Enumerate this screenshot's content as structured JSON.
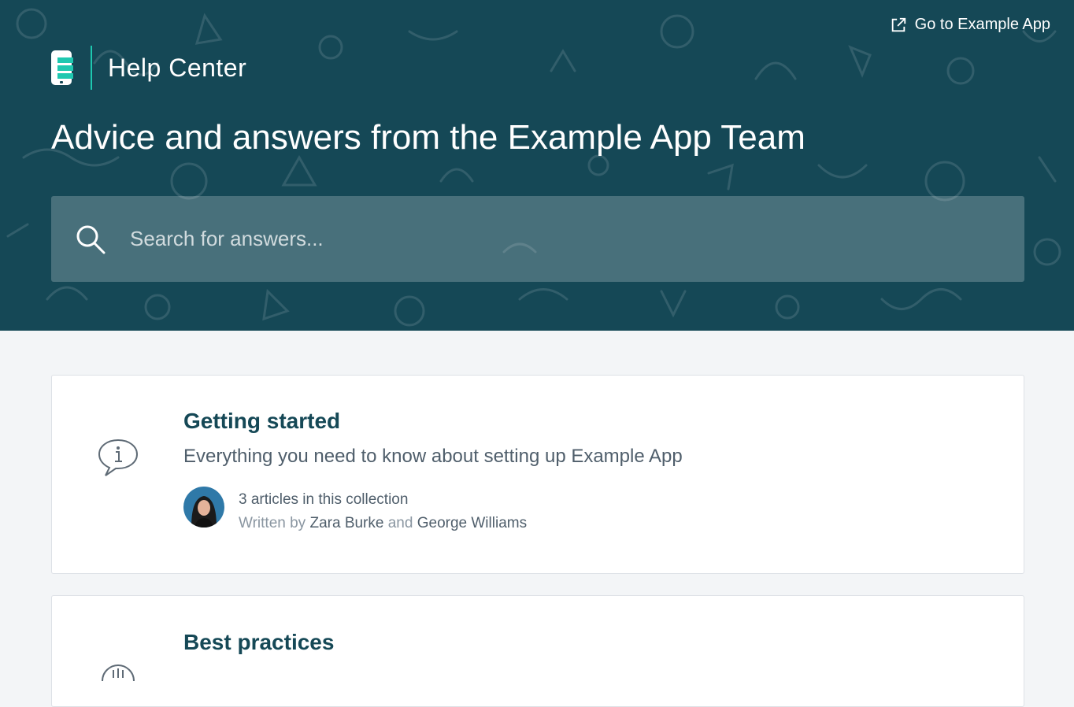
{
  "header": {
    "goto_link": "Go to Example App",
    "brand_title": "Help Center",
    "tagline": "Advice and answers from the Example App Team",
    "search_placeholder": "Search for answers...",
    "background_color": "#154856",
    "accent_color": "#1ec8b0"
  },
  "collections": [
    {
      "title": "Getting started",
      "description": "Everything you need to know about setting up Example App",
      "icon": "chat-info-icon",
      "article_count": "3 articles in this collection",
      "written_by_label": "Written by",
      "and_label": "and",
      "authors": [
        "Zara Burke",
        "George Williams"
      ]
    },
    {
      "title": "Best practices",
      "icon": "lightbulb-icon"
    }
  ]
}
